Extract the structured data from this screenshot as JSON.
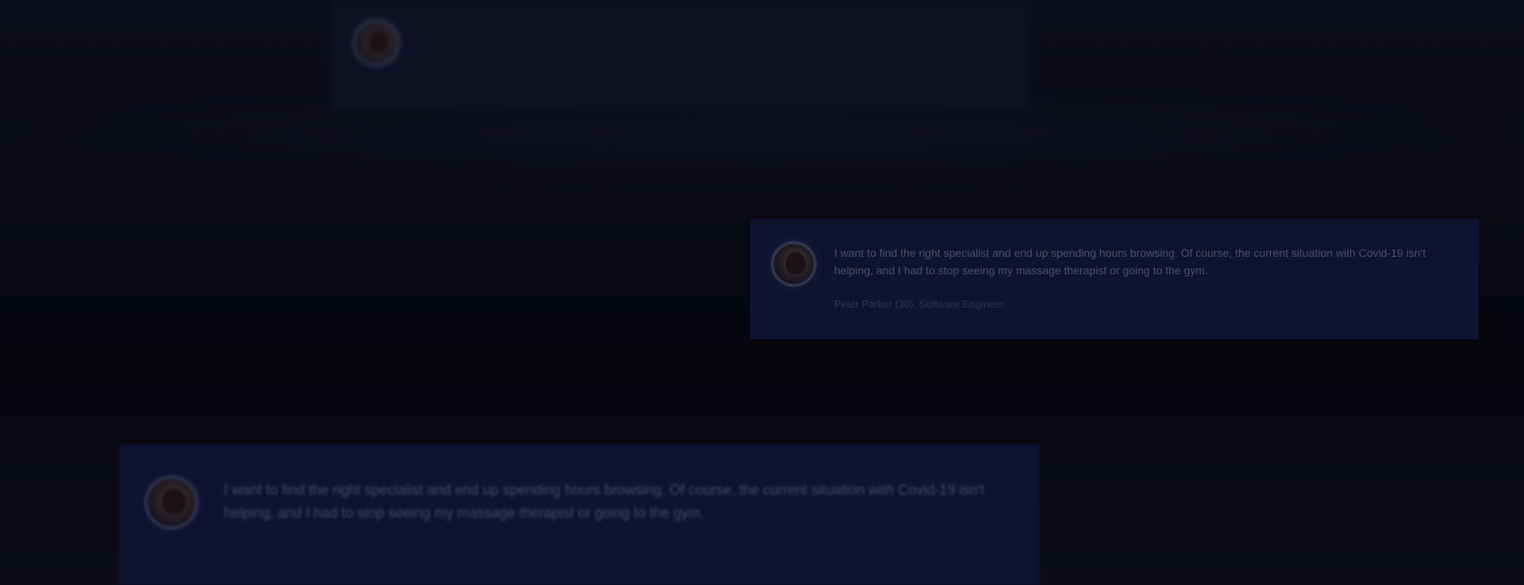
{
  "testimonials": [
    {
      "quote": "",
      "author": ""
    },
    {
      "quote": "I want to find the right specialist and end up spending hours browsing. Of course, the current situation with Covid-19 isn't helping, and I had to stop seeing my massage therapist or going to the gym.",
      "author": "Peter Parker (30), Software Engineer"
    },
    {
      "quote": "I want to find the right specialist and end up spending hours browsing. Of course, the current situation with Covid-19 isn't helping, and I had to stop seeing my massage therapist or going to the gym.",
      "author": ""
    }
  ]
}
